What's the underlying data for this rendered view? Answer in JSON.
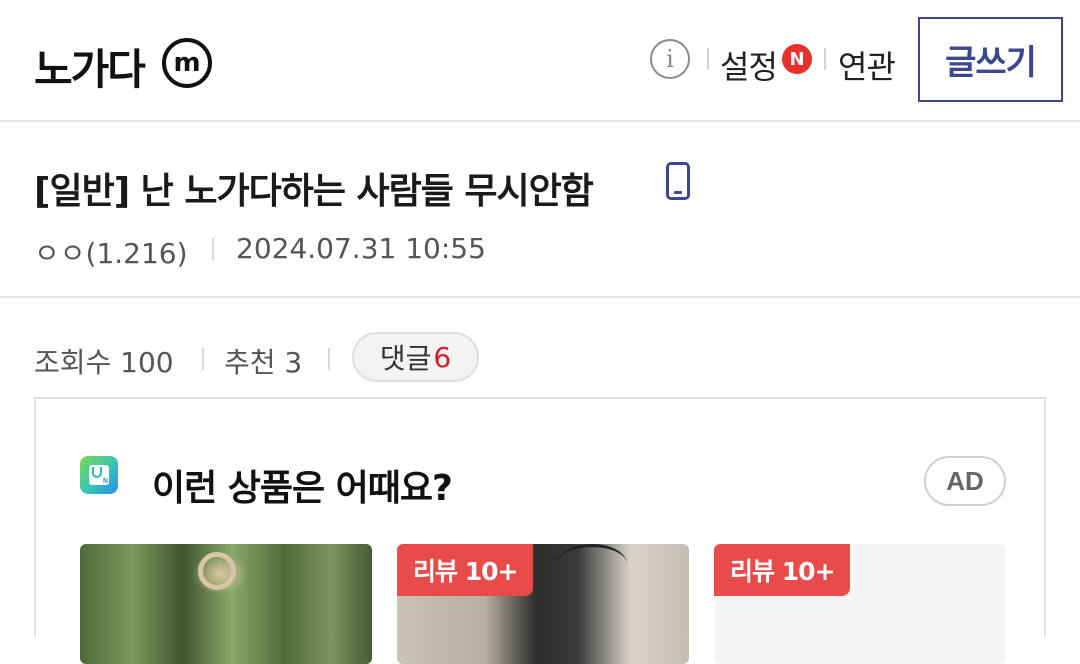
{
  "header": {
    "gallery_title": "노가다",
    "minor_badge": "m",
    "info_icon": "i",
    "settings_label": "설정",
    "new_badge": "N",
    "related_label": "연관",
    "write_button": "글쓰기"
  },
  "post": {
    "title": "[일반] 난 노가다하는 사람들 무시안함",
    "author": "ㅇㅇ(1.216)",
    "date": "2024.07.31 10:55"
  },
  "stats": {
    "views": "조회수 100",
    "recommend": "추천 3",
    "comments_label": "댓글",
    "comments_count": "6"
  },
  "ad": {
    "heading": "이런 상품은 어때요?",
    "badge": "AD",
    "products": [
      {
        "review_badge": ""
      },
      {
        "review_badge": "리뷰 10+"
      },
      {
        "review_badge": "리뷰 10+"
      }
    ]
  },
  "colors": {
    "accent": "#3b4890",
    "comment_count": "#d2232a",
    "new_badge": "#e8312b",
    "review_badge": "#e94a4a"
  },
  "icons": [
    "minor-gallery-icon",
    "info-icon",
    "mobile-icon",
    "shopping-logo-icon"
  ]
}
